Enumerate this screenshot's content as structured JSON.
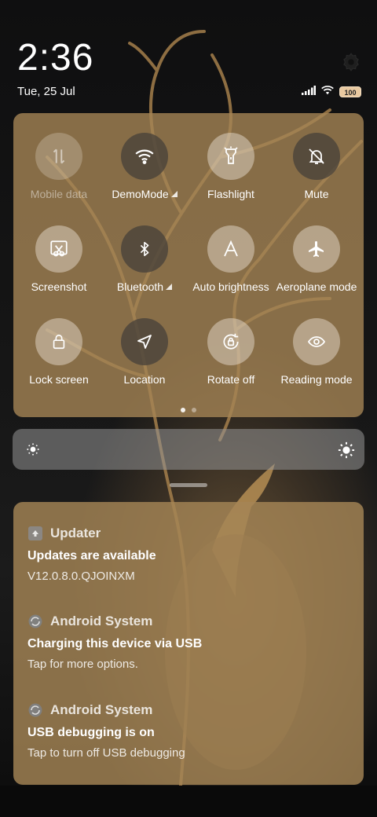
{
  "status_bar": {
    "time": "2:36",
    "date": "Tue, 25 Jul",
    "battery_level": "100",
    "icons": [
      "gear-icon",
      "cellular-signal-icon",
      "wifi-icon",
      "battery-icon"
    ]
  },
  "quick_settings": {
    "tiles": [
      {
        "id": "mobile-data",
        "label": "Mobile data",
        "icon": "mobile-data-icon",
        "state": "unavailable"
      },
      {
        "id": "wifi",
        "label": "DemoMode",
        "icon": "wifi-icon",
        "state": "on",
        "expandable": true
      },
      {
        "id": "flashlight",
        "label": "Flashlight",
        "icon": "flashlight-icon",
        "state": "off"
      },
      {
        "id": "mute",
        "label": "Mute",
        "icon": "bell-off-icon",
        "state": "on"
      },
      {
        "id": "screenshot",
        "label": "Screenshot",
        "icon": "scissors-icon",
        "state": "off"
      },
      {
        "id": "bluetooth",
        "label": "Bluetooth",
        "icon": "bluetooth-icon",
        "state": "on",
        "expandable": true
      },
      {
        "id": "auto-brightness",
        "label": "Auto brightness",
        "icon": "auto-brightness-icon",
        "state": "off"
      },
      {
        "id": "aeroplane-mode",
        "label": "Aeroplane mode",
        "icon": "airplane-icon",
        "state": "off"
      },
      {
        "id": "lock-screen",
        "label": "Lock screen",
        "icon": "lock-icon",
        "state": "off"
      },
      {
        "id": "location",
        "label": "Location",
        "icon": "location-arrow-icon",
        "state": "on"
      },
      {
        "id": "rotate-off",
        "label": "Rotate off",
        "icon": "rotation-lock-icon",
        "state": "off"
      },
      {
        "id": "reading-mode",
        "label": "Reading mode",
        "icon": "eye-icon",
        "state": "off"
      }
    ],
    "page_count": 2,
    "current_page": 1
  },
  "brightness_slider": {
    "left_icon": "brightness-low-icon",
    "right_icon": "brightness-high-icon"
  },
  "notifications": [
    {
      "app": "Updater",
      "app_icon": "updater-icon",
      "title": "Updates are available",
      "body": "V12.0.8.0.QJOINXM"
    },
    {
      "app": "Android System",
      "app_icon": "android-system-icon",
      "title": "Charging this device via USB",
      "body": "Tap for more options."
    },
    {
      "app": "Android System",
      "app_icon": "android-system-icon",
      "title": "USB debugging is on",
      "body": "Tap to turn off USB debugging"
    }
  ],
  "colors": {
    "panel": "#a58555",
    "tile_on": "#48413a",
    "tile_off": "#e8ded0",
    "battery_badge": "#e9c9a0"
  }
}
